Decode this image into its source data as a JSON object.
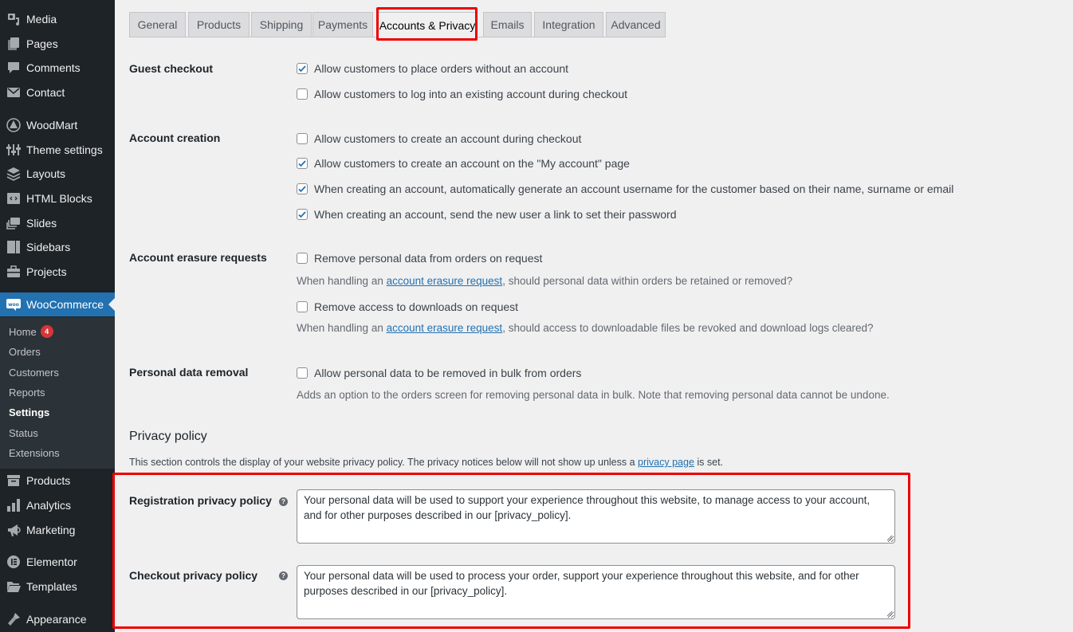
{
  "sidebar": {
    "items": [
      {
        "label": "Media",
        "icon": "media-icon"
      },
      {
        "label": "Pages",
        "icon": "pages-icon"
      },
      {
        "label": "Comments",
        "icon": "comments-icon"
      },
      {
        "label": "Contact",
        "icon": "mail-icon"
      },
      {
        "label": "WoodMart",
        "icon": "woodmart-icon"
      },
      {
        "label": "Theme settings",
        "icon": "sliders-icon"
      },
      {
        "label": "Layouts",
        "icon": "layers-icon"
      },
      {
        "label": "HTML Blocks",
        "icon": "code-icon"
      },
      {
        "label": "Slides",
        "icon": "slides-icon"
      },
      {
        "label": "Sidebars",
        "icon": "sidebars-icon"
      },
      {
        "label": "Projects",
        "icon": "briefcase-icon"
      },
      {
        "label": "WooCommerce",
        "icon": "woo-icon",
        "active": true
      },
      {
        "label": "Products",
        "icon": "archive-icon"
      },
      {
        "label": "Analytics",
        "icon": "bar-chart-icon"
      },
      {
        "label": "Marketing",
        "icon": "megaphone-icon"
      },
      {
        "label": "Elementor",
        "icon": "elementor-icon"
      },
      {
        "label": "Templates",
        "icon": "folder-icon"
      },
      {
        "label": "Appearance",
        "icon": "brush-icon"
      }
    ],
    "submenu": [
      {
        "label": "Home",
        "badge": "4"
      },
      {
        "label": "Orders"
      },
      {
        "label": "Customers"
      },
      {
        "label": "Reports"
      },
      {
        "label": "Settings",
        "current": true
      },
      {
        "label": "Status"
      },
      {
        "label": "Extensions"
      }
    ]
  },
  "tabs": [
    {
      "label": "General"
    },
    {
      "label": "Products"
    },
    {
      "label": "Shipping"
    },
    {
      "label": "Payments"
    },
    {
      "label": "Accounts & Privacy",
      "active": true
    },
    {
      "label": "Emails"
    },
    {
      "label": "Integration"
    },
    {
      "label": "Advanced"
    }
  ],
  "settings": {
    "guest_checkout": {
      "label": "Guest checkout",
      "options": [
        {
          "label": "Allow customers to place orders without an account",
          "checked": true
        },
        {
          "label": "Allow customers to log into an existing account during checkout",
          "checked": false
        }
      ]
    },
    "account_creation": {
      "label": "Account creation",
      "options": [
        {
          "label": "Allow customers to create an account during checkout",
          "checked": false
        },
        {
          "label": "Allow customers to create an account on the \"My account\" page",
          "checked": true
        },
        {
          "label": "When creating an account, automatically generate an account username for the customer based on their name, surname or email",
          "checked": true
        },
        {
          "label": "When creating an account, send the new user a link to set their password",
          "checked": true
        }
      ]
    },
    "account_erasure": {
      "label": "Account erasure requests",
      "options": [
        {
          "label": "Remove personal data from orders on request",
          "checked": false,
          "desc_before": "When handling an ",
          "desc_link": "account erasure request",
          "desc_after": ", should personal data within orders be retained or removed?"
        },
        {
          "label": "Remove access to downloads on request",
          "checked": false,
          "desc_before": "When handling an ",
          "desc_link": "account erasure request",
          "desc_after": ", should access to downloadable files be revoked and download logs cleared?"
        }
      ]
    },
    "personal_data_removal": {
      "label": "Personal data removal",
      "option": {
        "label": "Allow personal data to be removed in bulk from orders",
        "checked": false
      },
      "desc": "Adds an option to the orders screen for removing personal data in bulk. Note that removing personal data cannot be undone."
    }
  },
  "privacy": {
    "title": "Privacy policy",
    "desc_before": "This section controls the display of your website privacy policy. The privacy notices below will not show up unless a ",
    "desc_link": "privacy page",
    "desc_after": " is set.",
    "registration": {
      "label": "Registration privacy policy",
      "value": "Your personal data will be used to support your experience throughout this website, to manage access to your account, and for other purposes described in our [privacy_policy]."
    },
    "checkout": {
      "label": "Checkout privacy policy",
      "value": "Your personal data will be used to process your order, support your experience throughout this website, and for other purposes described in our [privacy_policy]."
    },
    "help_glyph": "?"
  },
  "colors": {
    "accent": "#2271b1",
    "sidebar_bg": "#1d2327",
    "highlight": "#ee0000",
    "badge": "#d63638"
  }
}
